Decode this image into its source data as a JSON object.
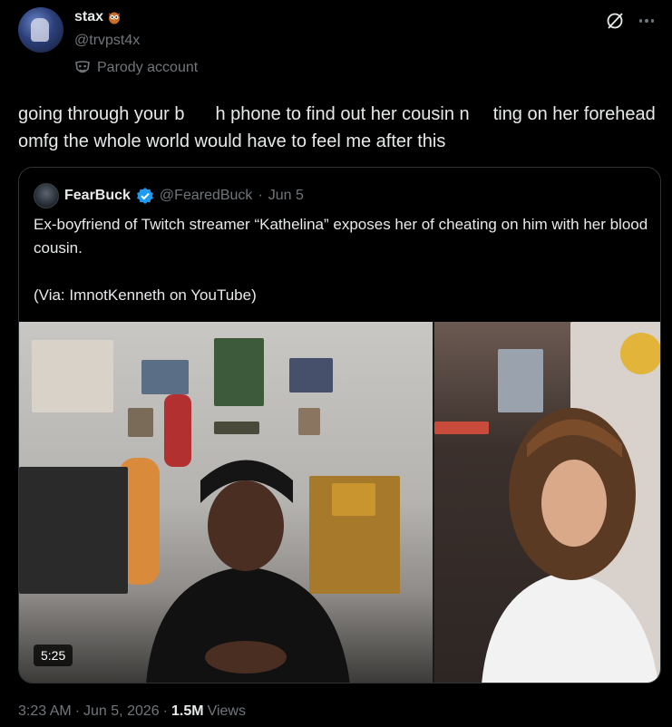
{
  "tweet": {
    "author": {
      "display_name": "stax",
      "name_emoji_icon": "owl-icon",
      "handle": "@trvpst4x",
      "parody_label": "Parody account"
    },
    "text_part1": "going through your b",
    "text_part2": "h phone to find out her cousin n",
    "text_part3": "ting on her forehead omfg the whole world would have to feel me after this",
    "timestamp": "3:23 AM",
    "date": "Jun 5, 2026",
    "views_count": "1.5M",
    "views_label": "Views"
  },
  "quote": {
    "author": {
      "display_name": "FearBuck",
      "handle": "@FearedBuck",
      "date": "Jun 5"
    },
    "text": "Ex-boyfriend of Twitch streamer “Kathelina” exposes her of cheating on him with her blood cousin.\n\n(Via: ImnotKenneth on YouTube)",
    "video_duration": "5:25"
  },
  "colors": {
    "background": "#000000",
    "text_primary": "#e7e9ea",
    "text_secondary": "#71767b",
    "border": "#2f3336",
    "verified": "#1d9bf0"
  }
}
